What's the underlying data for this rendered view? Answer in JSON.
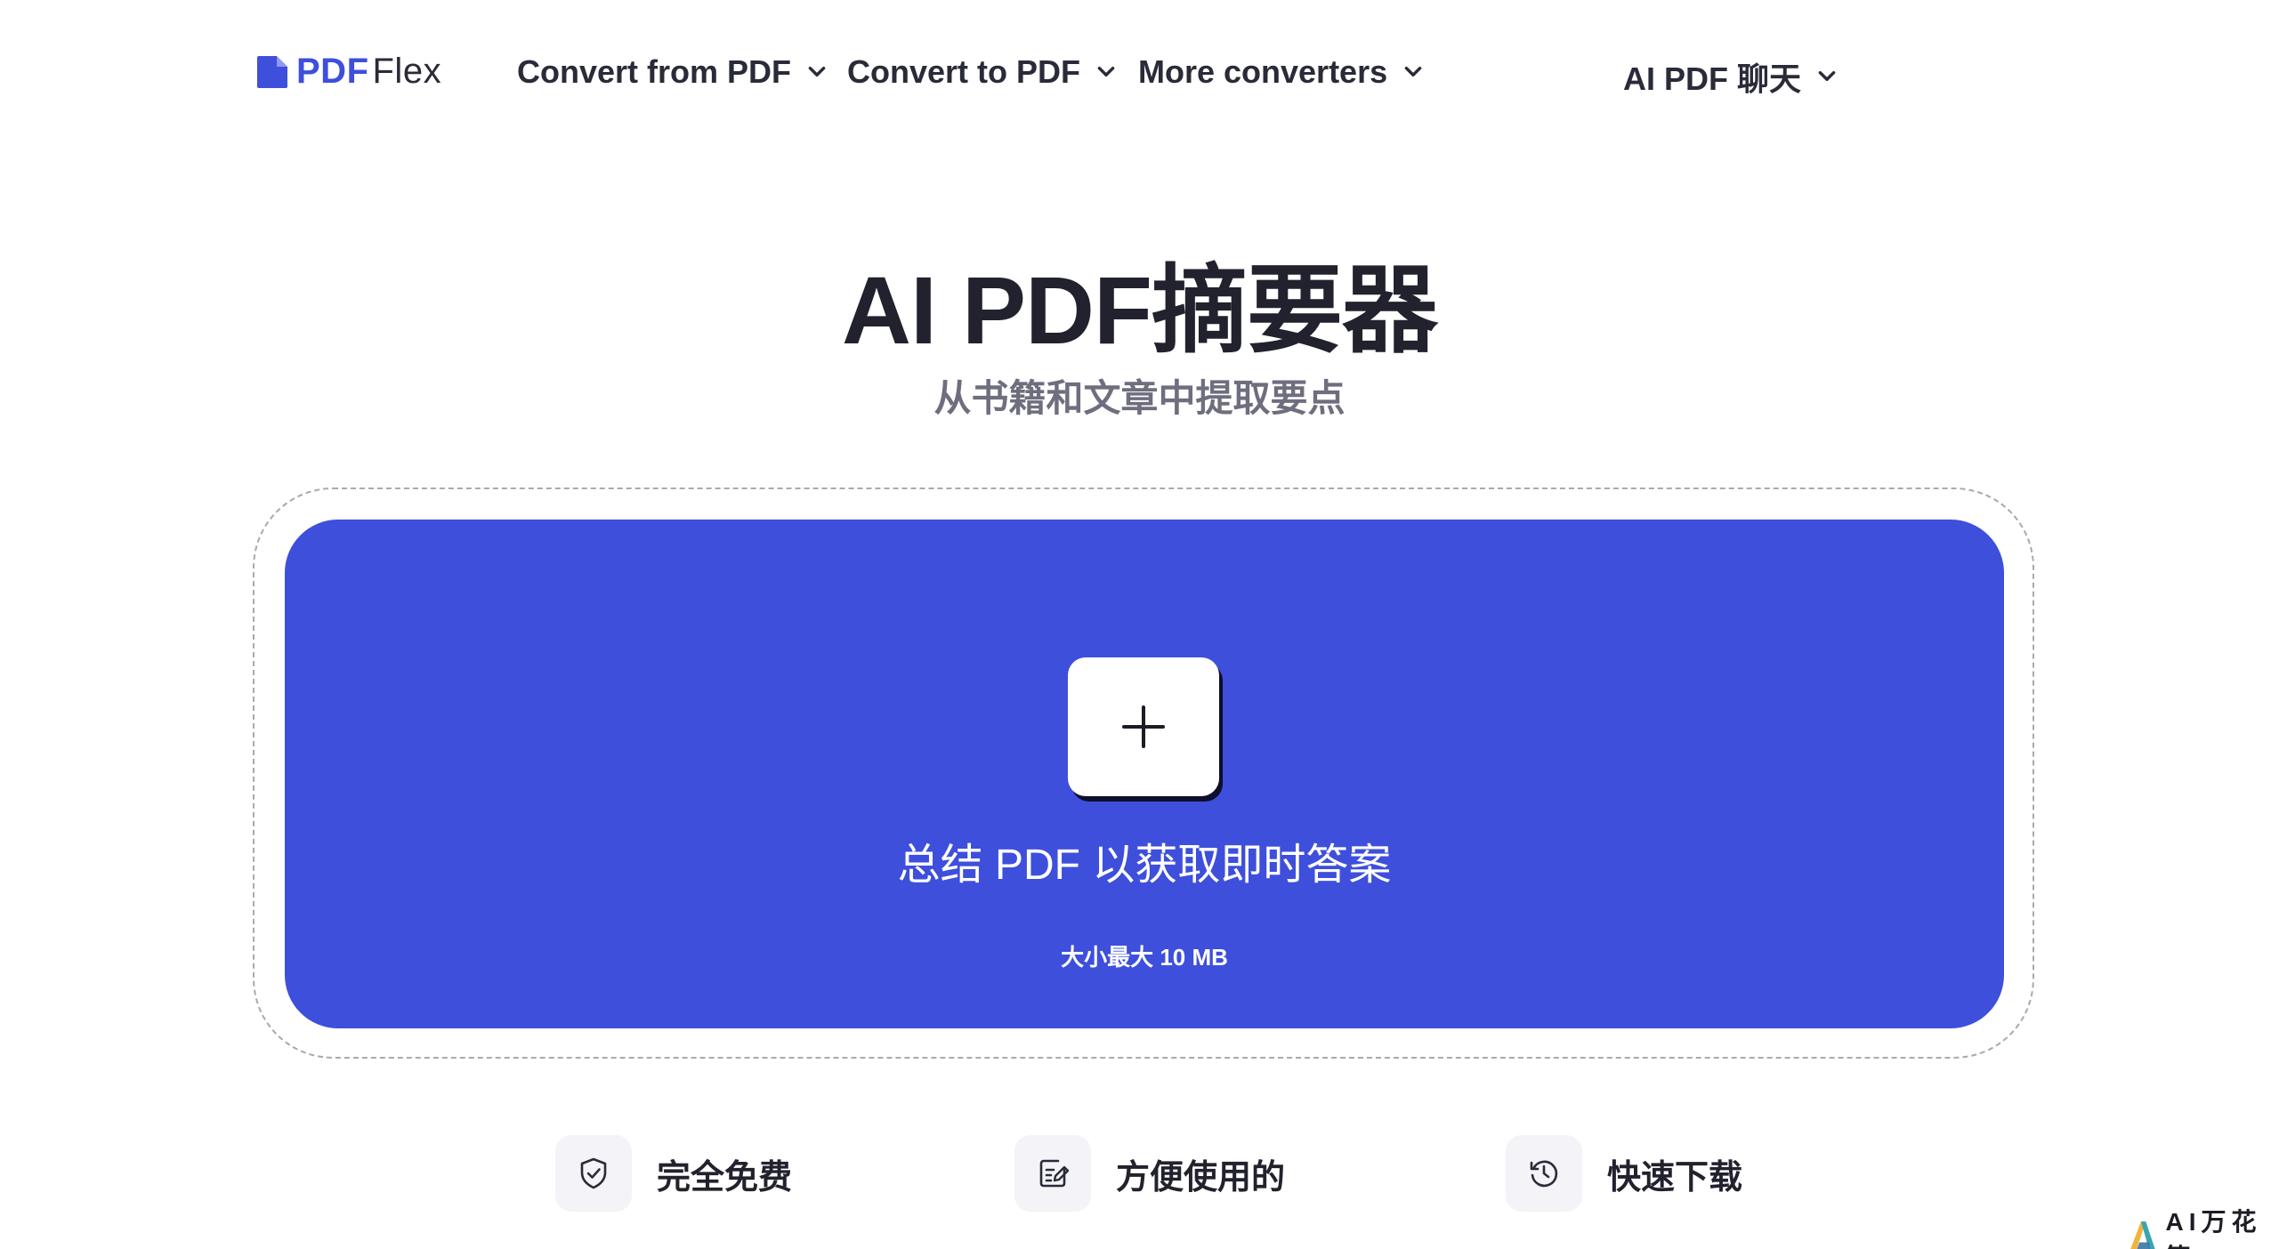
{
  "header": {
    "logo": {
      "brand_part1": "PDF",
      "brand_part2": "Flex"
    },
    "nav": [
      {
        "label": "Convert from PDF"
      },
      {
        "label": "Convert to PDF"
      },
      {
        "label": "More converters"
      },
      {
        "label": "AI PDF 聊天"
      }
    ]
  },
  "hero": {
    "title": "AI PDF摘要器",
    "subtitle": "从书籍和文章中提取要点"
  },
  "upload": {
    "label": "总结 PDF 以获取即时答案",
    "size_limit": "大小最大 10 MB"
  },
  "features": [
    {
      "label": "完全免费",
      "icon": "shield-check-icon"
    },
    {
      "label": "方便使用的",
      "icon": "edit-note-icon"
    },
    {
      "label": "快速下载",
      "icon": "history-clock-icon"
    }
  ],
  "watermark": {
    "text": "AI万花筒"
  },
  "colors": {
    "accent": "#3e4fdc",
    "text_dark": "#22222e",
    "text_muted": "#6e6e7e",
    "icon_bg": "#f3f3f8"
  }
}
